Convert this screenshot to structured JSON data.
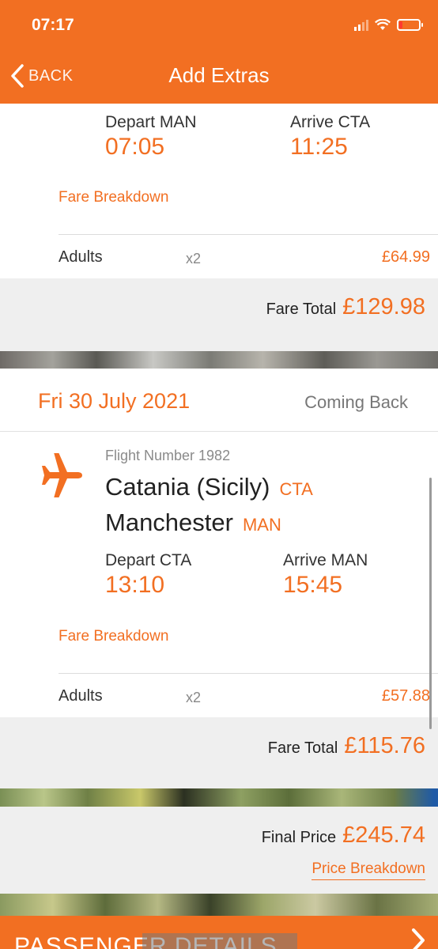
{
  "status": {
    "time": "07:17"
  },
  "nav": {
    "back_label": "BACK",
    "title": "Add Extras"
  },
  "outbound": {
    "depart_label": "Depart MAN",
    "depart_time": "07:05",
    "arrive_label": "Arrive CTA",
    "arrive_time": "11:25",
    "fare_breakdown_label": "Fare Breakdown",
    "fare_row": {
      "label": "Adults",
      "qty": "x2",
      "price": "£64.99"
    },
    "fare_total_label": "Fare Total",
    "fare_total_value": "£129.98"
  },
  "return": {
    "date": "Fri 30 July 2021",
    "direction": "Coming Back",
    "flight_number": "Flight Number 1982",
    "from_city": "Catania (Sicily)",
    "from_code": "CTA",
    "to_city": "Manchester",
    "to_code": "MAN",
    "depart_label": "Depart CTA",
    "depart_time": "13:10",
    "arrive_label": "Arrive MAN",
    "arrive_time": "15:45",
    "fare_breakdown_label": "Fare Breakdown",
    "fare_row": {
      "label": "Adults",
      "qty": "x2",
      "price": "£57.88"
    },
    "fare_total_label": "Fare Total",
    "fare_total_value": "£115.76"
  },
  "summary": {
    "final_price_label": "Final Price",
    "final_price_value": "£245.74",
    "price_breakdown_label": "Price Breakdown"
  },
  "footer": {
    "button_label": "PASSENGER DETAILS"
  },
  "colors": {
    "accent": "#f26f22",
    "band": "#efefef"
  }
}
